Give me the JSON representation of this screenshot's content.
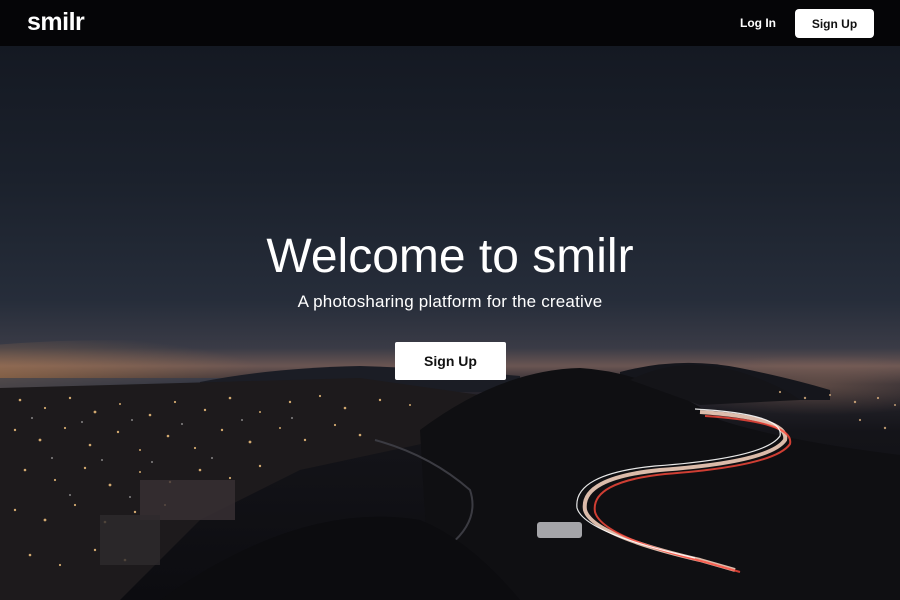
{
  "header": {
    "logo": "smilr",
    "login_label": "Log In",
    "signup_label": "Sign Up"
  },
  "hero": {
    "title": "Welcome to smilr",
    "subtitle": "A photosharing platform for the creative",
    "signup_label": "Sign Up"
  },
  "colors": {
    "header_bg": "#050507",
    "button_bg": "#ffffff",
    "text": "#ffffff"
  }
}
